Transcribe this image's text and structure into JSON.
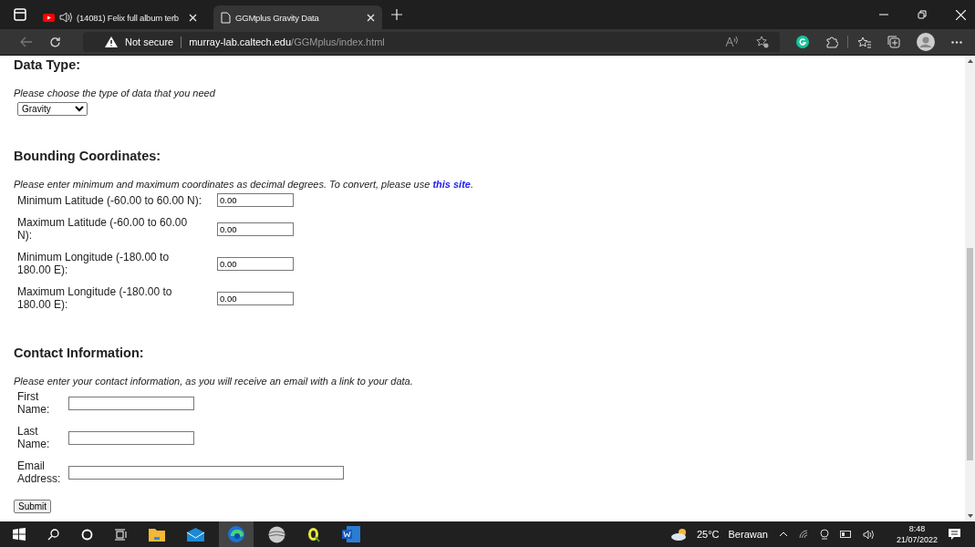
{
  "browser": {
    "tabs": [
      {
        "title": "(14081) Felix full album terb",
        "selected": false,
        "audio": true
      },
      {
        "title": "GGMplus Gravity Data",
        "selected": true,
        "audio": false
      }
    ],
    "security": "Not secure",
    "url_host": "murray-lab.caltech.edu",
    "url_path": "/GGMplus/index.html"
  },
  "sections": [
    {
      "heading": "Data Type:",
      "description": "Please choose the type of data that you need",
      "select": "Gravity"
    },
    {
      "heading": "Bounding Coordinates:",
      "description": "Please enter minimum and maximum coordinates as decimal degrees. To convert, please use ",
      "link": "this site",
      "after_link": ".",
      "fields": [
        {
          "label": "Minimum Latitude (-60.00 to 60.00 N):",
          "value": "0.00"
        },
        {
          "label": "Maximum Latitude (-60.00 to 60.00 N):",
          "value": "0.00"
        },
        {
          "label": "Minimum Longitude (-180.00 to 180.00 E):",
          "value": "0.00"
        },
        {
          "label": "Maximum Longitude (-180.00 to 180.00 E):",
          "value": "0.00"
        }
      ]
    },
    {
      "heading": "Contact Information:",
      "description": "Please enter your contact information, as you will receive an email with a link to your data.",
      "kind": "contact",
      "fields": [
        {
          "label": "First Name:"
        },
        {
          "label": "Last Name:"
        },
        {
          "label": "Email Address:",
          "wide": true
        }
      ]
    }
  ],
  "submit": "Submit",
  "taskbar": {
    "temperature": "25°C",
    "weather": "Berawan",
    "time": "8:48",
    "date": "21/07/2022"
  }
}
